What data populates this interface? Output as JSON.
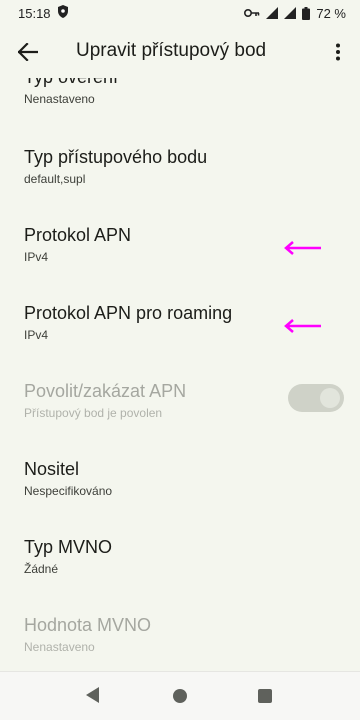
{
  "status_bar": {
    "time": "15:18",
    "battery": "72 %"
  },
  "app_bar": {
    "title": "Upravit přístupový bod"
  },
  "preferences": [
    {
      "title": "Typ ověření",
      "summary": "Nenastaveno",
      "enabled": true
    },
    {
      "title": "Typ přístupového bodu",
      "summary": "default,supl",
      "enabled": true
    },
    {
      "title": "Protokol APN",
      "summary": "IPv4",
      "enabled": true,
      "annotated": true
    },
    {
      "title": "Protokol APN pro roaming",
      "summary": "IPv4",
      "enabled": true,
      "annotated": true
    },
    {
      "title": "Povolit/zakázat APN",
      "summary": "Přístupový bod je povolen",
      "enabled": false,
      "switch_on": true
    },
    {
      "title": "Nositel",
      "summary": "Nespecifikováno",
      "enabled": true
    },
    {
      "title": "Typ MVNO",
      "summary": "Žádné",
      "enabled": true
    },
    {
      "title": "Hodnota MVNO",
      "summary": "Nenastaveno",
      "enabled": false
    }
  ],
  "colors": {
    "annotation_arrow": "#ff00ff",
    "background": "#f4f6ee"
  },
  "icons": {
    "status": [
      "shield-icon",
      "vpn-key-icon",
      "signal-icon",
      "battery-icon"
    ],
    "app_bar": [
      "arrow-back-icon",
      "more-vert-icon"
    ],
    "nav": [
      "nav-back-icon",
      "nav-home-icon",
      "nav-recents-icon"
    ]
  }
}
